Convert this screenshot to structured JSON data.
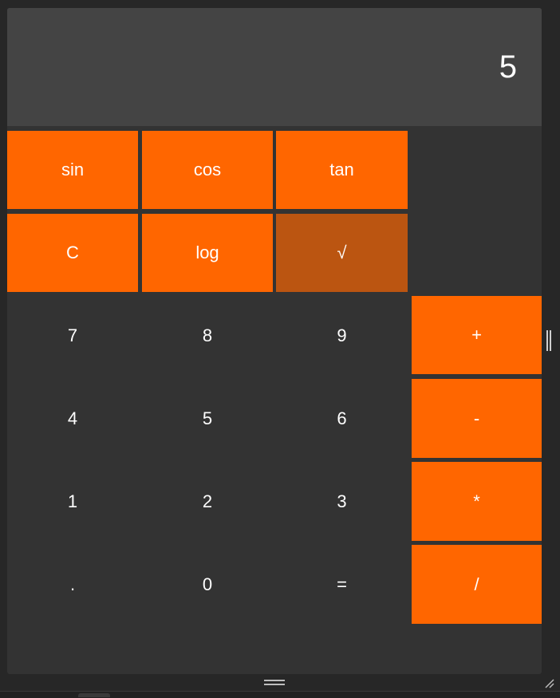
{
  "display": {
    "value": "5"
  },
  "keys": {
    "sin": "sin",
    "cos": "cos",
    "tan": "tan",
    "clear": "C",
    "log": "log",
    "sqrt": "√",
    "seven": "7",
    "eight": "8",
    "nine": "9",
    "plus": "+",
    "four": "4",
    "five": "5",
    "six": "6",
    "minus": "-",
    "one": "1",
    "two": "2",
    "three": "3",
    "multiply": "*",
    "decimal": ".",
    "zero": "0",
    "equals": "=",
    "divide": "/"
  },
  "colors": {
    "accent": "#ff6600",
    "accent_pressed": "#bb5511",
    "display_bg": "#444444",
    "keypad_bg": "#333333",
    "window_bg": "#272727"
  },
  "icons": {
    "splitter": "vertical-splitter-grip-icon",
    "bottom_grip": "horizontal-splitter-grip-icon",
    "corner": "resize-corner-icon"
  }
}
